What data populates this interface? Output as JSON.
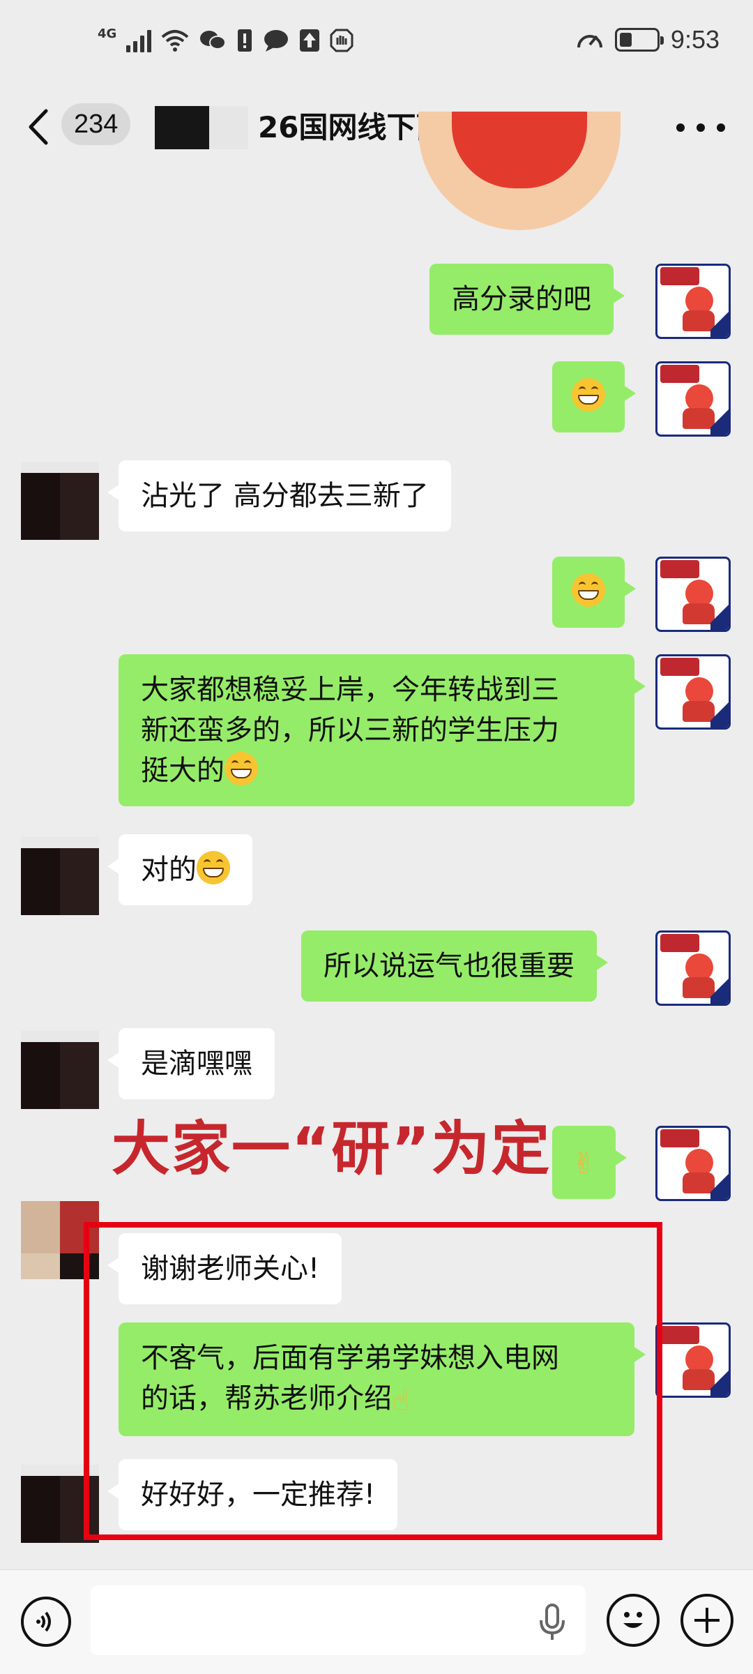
{
  "status_bar": {
    "network": "4G",
    "time": "9:53",
    "battery_level": 0.35,
    "icons": [
      "signal-icon",
      "wifi-icon",
      "wechat-icon",
      "sim-alert-icon",
      "message-icon",
      "upload-icon",
      "shield-icon",
      "speedometer-icon",
      "battery-icon"
    ]
  },
  "header": {
    "unread_count": "234",
    "title": "26国网线下面试协议班"
  },
  "messages": [
    {
      "side": "me",
      "text": "高分录的吧"
    },
    {
      "side": "me",
      "text": "",
      "emoji": "grin-emoji"
    },
    {
      "side": "other",
      "text": "沾光了 高分都去三新了"
    },
    {
      "side": "me",
      "text": "",
      "emoji": "grin-emoji"
    },
    {
      "side": "me",
      "text_lines": [
        "大家都想稳妥上岸，今年转战到三",
        "新还蛮多的，所以三新的学生压力",
        "挺大的"
      ],
      "emoji": "grin-emoji"
    },
    {
      "side": "other",
      "text": "对的",
      "emoji": "grin-emoji"
    },
    {
      "side": "me",
      "text": "所以说运气也很重要"
    },
    {
      "side": "other",
      "text": "是滴嘿嘿"
    },
    {
      "side": "me",
      "text": "",
      "emoji": "victory-hand-emoji"
    },
    {
      "side": "other",
      "text": "谢谢老师关心!"
    },
    {
      "side": "me",
      "text_lines": [
        "不客气，后面有学弟学妹想入电网",
        "的话，帮苏老师介绍"
      ],
      "emoji": "pray-hands-emoji"
    },
    {
      "side": "other",
      "text": "好好好，一定推荐!"
    }
  ],
  "overlay": {
    "slogan": "大家一“研”为定",
    "color": "#c6272d",
    "highlight_color": "#e60012"
  },
  "colors": {
    "bubble_me": "#95ec69",
    "bubble_other": "#ffffff",
    "background": "#ededed"
  },
  "input_bar": {
    "placeholder": "",
    "icons": [
      "voice-icon",
      "mic-icon",
      "emoji-icon",
      "plus-icon"
    ]
  }
}
